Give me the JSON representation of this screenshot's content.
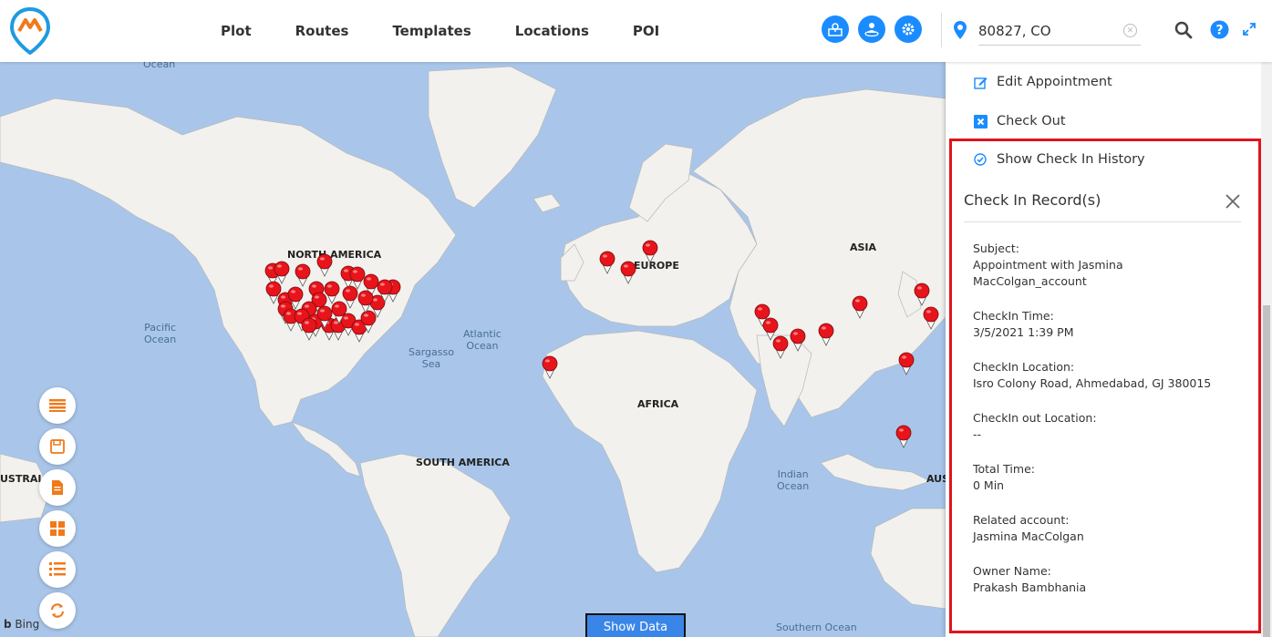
{
  "nav": {
    "items": [
      "Plot",
      "Routes",
      "Templates",
      "Locations",
      "POI"
    ]
  },
  "location_search": {
    "value": "80827, CO"
  },
  "map": {
    "labels": {
      "ocean_top": "Ocean",
      "north_america": "NORTH AMERICA",
      "europe": "EUROPE",
      "asia": "ASIA",
      "africa": "AFRICA",
      "south_america": "SOUTH AMERICA",
      "australia": "USTRALI",
      "australia_right": "AUS",
      "pacific": "Pacific\nOcean",
      "atlantic": "Atlantic\nOcean",
      "sargasso": "Sargasso\nSea",
      "indian": "Indian\nOcean",
      "southern": "Southern Ocean"
    },
    "attribution": "Bing",
    "show_data_label": "Show Data",
    "colors": {
      "water": "#a9c6ea",
      "land": "#f2f1ee",
      "pin": "#e8141c"
    }
  },
  "panel": {
    "edit_label": "Edit Appointment",
    "checkout_label": "Check Out",
    "history_label": "Show Check In History",
    "record_title": "Check In Record(s)",
    "fields": [
      {
        "label": "Subject:",
        "value": "Appointment with Jasmina MacColgan_account"
      },
      {
        "label": "CheckIn Time:",
        "value": "3/5/2021 1:39 PM"
      },
      {
        "label": "CheckIn Location:",
        "value": "Isro Colony Road, Ahmedabad, GJ 380015"
      },
      {
        "label": "CheckIn out Location:",
        "value": "--"
      },
      {
        "label": "Total Time:",
        "value": "0 Min"
      },
      {
        "label": "Related account:",
        "value": "Jasmina MacColgan"
      },
      {
        "label": "Owner Name:",
        "value": "Prakash Bambhania"
      }
    ]
  }
}
